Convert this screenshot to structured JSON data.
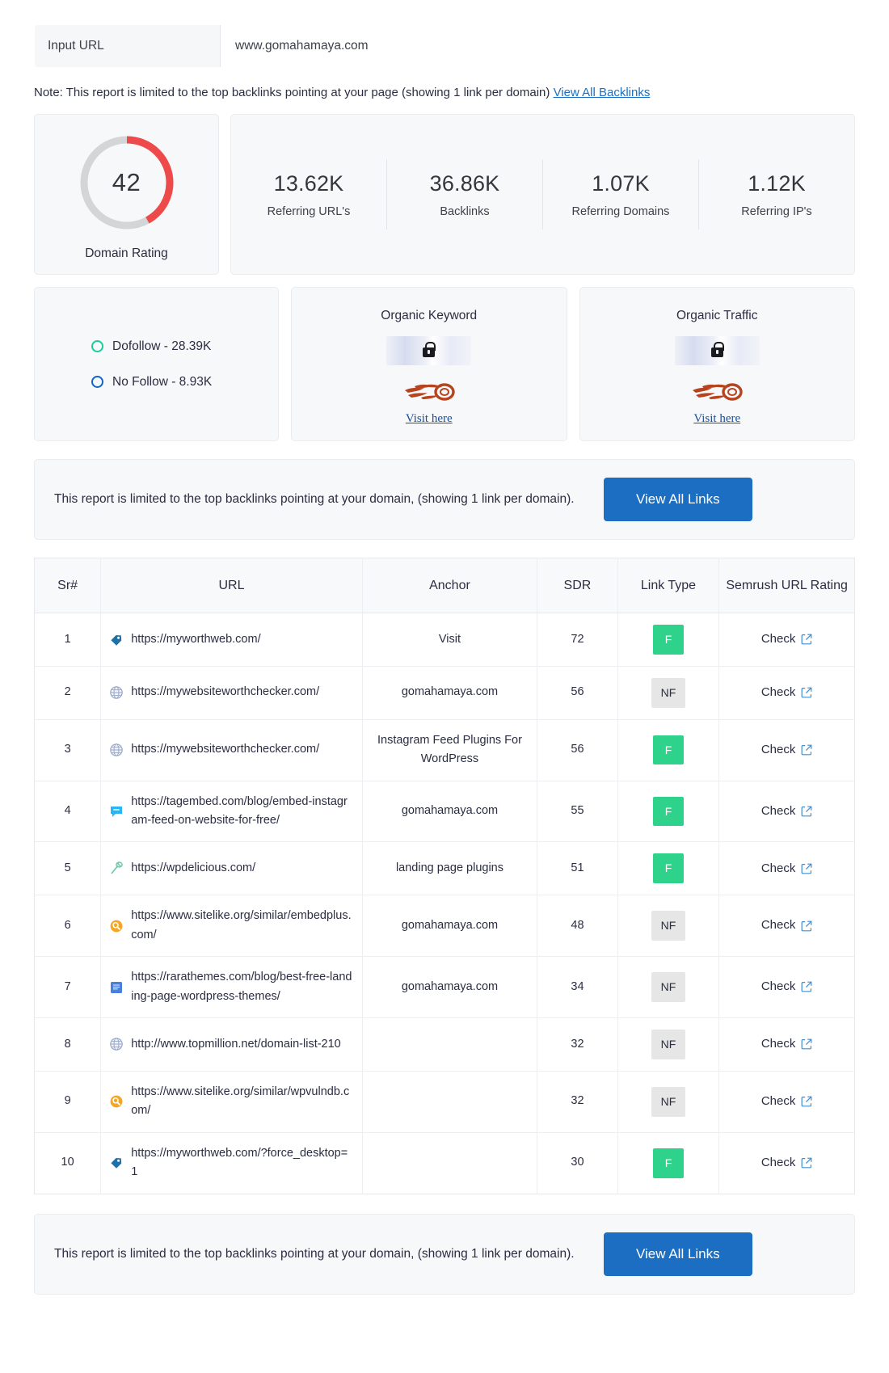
{
  "input": {
    "label": "Input URL",
    "value": "www.gomahamaya.com"
  },
  "note": {
    "text": "Note: This report is limited to the top backlinks pointing at your page (showing 1 link per domain)",
    "link_label": "View All Backlinks"
  },
  "domain_rating": {
    "value": "42",
    "caption": "Domain Rating",
    "arc_color": "#ef4a4a",
    "track_color": "#d4d5d7",
    "percent": 42
  },
  "stats": [
    {
      "value": "13.62K",
      "label": "Referring URL's"
    },
    {
      "value": "36.86K",
      "label": "Backlinks"
    },
    {
      "value": "1.07K",
      "label": "Referring Domains"
    },
    {
      "value": "1.12K",
      "label": "Referring IP's"
    }
  ],
  "follow": {
    "dofollow": {
      "label": "Dofollow - 28.39K",
      "color": "#20c997"
    },
    "nofollow": {
      "label": "No Follow - 8.93K",
      "color": "#1565c0"
    }
  },
  "organic": [
    {
      "title": "Organic Keyword",
      "locked": true,
      "cta": "Visit here"
    },
    {
      "title": "Organic Traffic",
      "locked": true,
      "cta": "Visit here"
    }
  ],
  "banner_top": {
    "text": "This report is limited to the top backlinks pointing at your domain, (showing 1 link per domain).",
    "button": "View All Links"
  },
  "banner_bottom": {
    "text": "This report is limited to the top backlinks pointing at your domain, (showing 1 link per domain).",
    "button": "View All Links"
  },
  "table": {
    "headers": [
      "Sr#",
      "URL",
      "Anchor",
      "SDR",
      "Link Type",
      "Semrush URL Rating"
    ],
    "rating_label": "Check",
    "rows": [
      {
        "sr": "1",
        "url": "https://myworthweb.com/",
        "icon": "tag-icon",
        "anchor": "Visit",
        "sdr": "72",
        "type": "F",
        "rating": "Check"
      },
      {
        "sr": "2",
        "url": "https://mywebsiteworthchecker.com/",
        "icon": "globe-icon",
        "anchor": "gomahamaya.com",
        "sdr": "56",
        "type": "NF",
        "rating": "Check"
      },
      {
        "sr": "3",
        "url": "https://mywebsiteworthchecker.com/",
        "icon": "globe-icon",
        "anchor": "Instagram Feed Plugins For WordPress",
        "sdr": "56",
        "type": "F",
        "rating": "Check"
      },
      {
        "sr": "4",
        "url": "https://tagembed.com/blog/embed-instagram-feed-on-website-for-free/",
        "icon": "tagembed-icon",
        "anchor": "gomahamaya.com",
        "sdr": "55",
        "type": "F",
        "rating": "Check"
      },
      {
        "sr": "5",
        "url": "https://wpdelicious.com/",
        "icon": "whisk-icon",
        "anchor": "landing page plugins",
        "sdr": "51",
        "type": "F",
        "rating": "Check"
      },
      {
        "sr": "6",
        "url": "https://www.sitelike.org/similar/embedplus.com/",
        "icon": "magnifier-icon",
        "anchor": "gomahamaya.com",
        "sdr": "48",
        "type": "NF",
        "rating": "Check"
      },
      {
        "sr": "7",
        "url": "https://rarathemes.com/blog/best-free-landing-page-wordpress-themes/",
        "icon": "document-icon",
        "anchor": "gomahamaya.com",
        "sdr": "34",
        "type": "NF",
        "rating": "Check"
      },
      {
        "sr": "8",
        "url": "http://www.topmillion.net/domain-list-210",
        "icon": "globe-icon",
        "anchor": "",
        "sdr": "32",
        "type": "NF",
        "rating": "Check"
      },
      {
        "sr": "9",
        "url": "https://www.sitelike.org/similar/wpvulndb.com/",
        "icon": "magnifier-icon",
        "anchor": "",
        "sdr": "32",
        "type": "NF",
        "rating": "Check"
      },
      {
        "sr": "10",
        "url": "https://myworthweb.com/?force_desktop=1",
        "icon": "tag-icon",
        "anchor": "",
        "sdr": "30",
        "type": "F",
        "rating": "Check"
      }
    ]
  },
  "colors": {
    "follow_badge": "#2fd28a",
    "nofollow_badge": "#e6e6e6",
    "primary_button": "#1b6ec2",
    "link": "#1a6fc4"
  }
}
